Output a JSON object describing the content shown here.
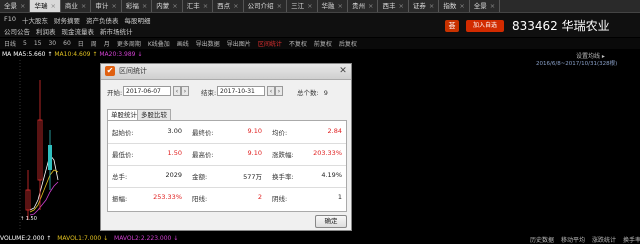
{
  "tabs": [
    "全景",
    "华瑞",
    "商业",
    "审计",
    "彩福",
    "内蒙",
    "汇丰",
    "西点",
    "公司介绍",
    "三江",
    "华融",
    "贵州",
    "西丰",
    "证券",
    "指数",
    "全景"
  ],
  "menu": {
    "row1": [
      "F10",
      "十大股东",
      "财务摘要",
      "资产负债表",
      "每股明细"
    ],
    "row2": [
      "公司公告",
      "利润表",
      "现金流量表",
      "新市场统计"
    ]
  },
  "header": {
    "btn_yao": "荟",
    "btn_zx": "闻",
    "add_label": "加入自选",
    "stock_title": "833462 华瑞农业"
  },
  "toolbar": [
    "日线",
    "5",
    "15",
    "30",
    "60",
    "日",
    "周",
    "月",
    "更多周期",
    "K线叠加",
    "画线",
    "导出数据",
    "导出图片",
    "区间统计",
    "不复权",
    "前复权",
    "后复权"
  ],
  "ma_line": "MA  MA5:5.660 ↑  MA10:4.609 ↑  MA20:3.989 ↓",
  "right_info": {
    "settings": "设置均线 ▸",
    "daterange": "2016/6/8~2017/10/31(328根)"
  },
  "left_price": "3.10",
  "bottom_price": "1.60",
  "vol_line": "VOLUME:2.000 ↑  MAVOL1:7.000 ↓  MAVOL2:2.223.000 ↓",
  "bottom_right": [
    "历史数据",
    "移动平均",
    "涨跌统计",
    "换手率"
  ],
  "dialog": {
    "title": "区间统计",
    "start_label": "开始:",
    "start_date": "2017-06-07",
    "end_label": "结束:",
    "end_date": "2017-10-31",
    "total_label": "总个数:",
    "total_value": "9",
    "tab1": "单股统计",
    "tab2": "多股比较",
    "stats": [
      [
        {
          "label": "起始价:",
          "value": "3.00",
          "color": "blk"
        },
        {
          "label": "最终价:",
          "value": "9.10",
          "color": "red"
        },
        {
          "label": "均价:",
          "value": "2.84",
          "color": "red"
        }
      ],
      [
        {
          "label": "最低价:",
          "value": "1.50",
          "color": "red"
        },
        {
          "label": "最高价:",
          "value": "9.10",
          "color": "red"
        },
        {
          "label": "涨跌幅:",
          "value": "203.33%",
          "color": "red"
        }
      ],
      [
        {
          "label": "总手:",
          "value": "2029",
          "color": "blk"
        },
        {
          "label": "金额:",
          "value": "577万",
          "color": "blk"
        },
        {
          "label": "换手率:",
          "value": "4.19%",
          "color": "blk"
        }
      ],
      [
        {
          "label": "振幅:",
          "value": "253.33%",
          "color": "red"
        },
        {
          "label": "阳线:",
          "value": "2",
          "color": "red"
        },
        {
          "label": "阴线:",
          "value": "1",
          "color": "blk"
        }
      ]
    ],
    "ok_label": "确定"
  }
}
